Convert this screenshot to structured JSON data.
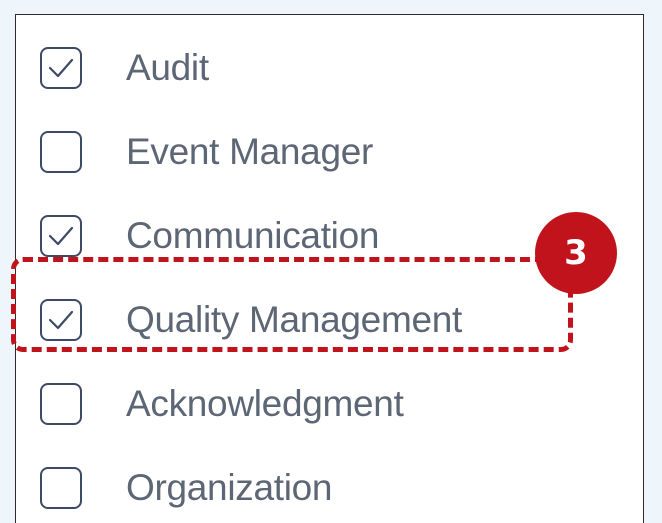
{
  "items": [
    {
      "label": "Audit",
      "checked": true
    },
    {
      "label": "Event Manager",
      "checked": false
    },
    {
      "label": "Communication",
      "checked": true
    },
    {
      "label": "Quality Management",
      "checked": true
    },
    {
      "label": "Acknowledgment",
      "checked": false
    },
    {
      "label": "Organization",
      "checked": false
    }
  ],
  "callout": {
    "step_number": "3",
    "highlighted_item": "Quality Management",
    "color": "#c0131b"
  },
  "colors": {
    "background": "#eef5fb",
    "checkbox_border": "#3d4a66",
    "label_text": "#5d6675"
  }
}
